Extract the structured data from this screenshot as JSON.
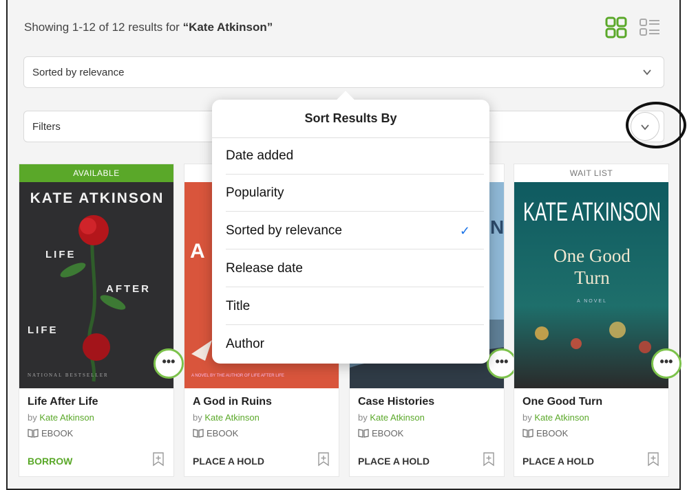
{
  "header": {
    "results_prefix": "Showing 1-12 of 12 results for ",
    "query": "“Kate Atkinson”"
  },
  "sort": {
    "selected_label": "Sorted by relevance"
  },
  "filters": {
    "label": "Filters"
  },
  "sort_popover": {
    "title": "Sort Results By",
    "options": [
      {
        "label": "Date added"
      },
      {
        "label": "Popularity"
      },
      {
        "label": "Sorted by relevance",
        "check": "✓"
      },
      {
        "label": "Release date"
      },
      {
        "label": "Title"
      },
      {
        "label": "Author"
      }
    ]
  },
  "books": [
    {
      "status": "AVAILABLE",
      "title": "Life After Life",
      "by": "by ",
      "author": "Kate Atkinson",
      "format": "EBOOK",
      "action": "BORROW",
      "cover": {
        "author_text": "KATE ATKINSON",
        "word1": "LIFE",
        "word2": "AFTER",
        "word3": "LIFE",
        "banner": "NATIONAL BESTSELLER"
      }
    },
    {
      "status": "",
      "title": "A God in Ruins",
      "by": "by ",
      "author": "Kate Atkinson",
      "format": "EBOOK",
      "action": "PLACE A HOLD",
      "cover": {
        "letter": "A",
        "banner": "A NOVEL BY THE AUTHOR OF LIFE AFTER LIFE"
      }
    },
    {
      "status": "",
      "title": "Case Histories",
      "by": "by ",
      "author": "Kate Atkinson",
      "format": "EBOOK",
      "action": "PLACE A HOLD",
      "cover": {
        "letter": "N"
      }
    },
    {
      "status": "WAIT LIST",
      "title": "One Good Turn",
      "by": "by ",
      "author": "Kate Atkinson",
      "format": "EBOOK",
      "action": "PLACE A HOLD",
      "cover": {
        "author_text": "KATE ATKINSON",
        "subtitle_line1": "One Good",
        "subtitle_line2": "Turn",
        "small": "A NOVEL"
      }
    }
  ],
  "icons": {
    "grid_view": "grid-icon",
    "list_view": "list-icon",
    "more": "more-icon",
    "wishlist": "bookmark-plus-icon",
    "format": "book-icon"
  },
  "colors": {
    "accent": "#5aa829",
    "check": "#1a73e8"
  }
}
